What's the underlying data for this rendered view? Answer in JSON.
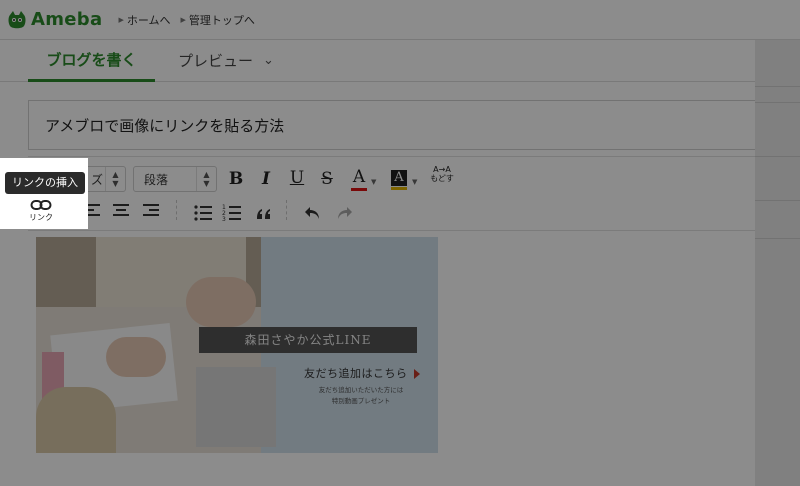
{
  "header": {
    "logo_text": "Ameba",
    "nav": [
      {
        "label": "ホームへ"
      },
      {
        "label": "管理トップへ"
      }
    ]
  },
  "tabs": {
    "write_label": "ブログを書く",
    "preview_label": "プレビュー"
  },
  "post": {
    "title": "アメブロで画像にリンクを貼る方法"
  },
  "toolbar": {
    "size_select_value": "ズ",
    "paragraph_select_value": "段落",
    "bold_label": "B",
    "italic_label": "I",
    "underline_label": "U",
    "strike_label": "S",
    "text_color_label": "A",
    "bg_color_label": "A",
    "revert_top": "A→A",
    "revert_bottom": "もどす",
    "link_label": "リンク",
    "link_tooltip": "リンクの挿入",
    "icons": [
      "link-icon",
      "align-left-icon",
      "align-center-icon",
      "align-right-icon",
      "bulleted-list-icon",
      "numbered-list-icon",
      "quote-icon",
      "undo-icon",
      "redo-icon"
    ]
  },
  "banner": {
    "title": "森田さやか公式LINE",
    "cta": "友だち追加はこちら",
    "sub_line1": "友だち追加いただいた方には",
    "sub_line2": "特別動画プレゼント"
  },
  "colors": {
    "brand_green": "#2d8b2d",
    "text_color_bar": "#dd1111",
    "bg_color_bar": "#e6b800",
    "overlay": "rgba(0,0,0,0.45)"
  }
}
